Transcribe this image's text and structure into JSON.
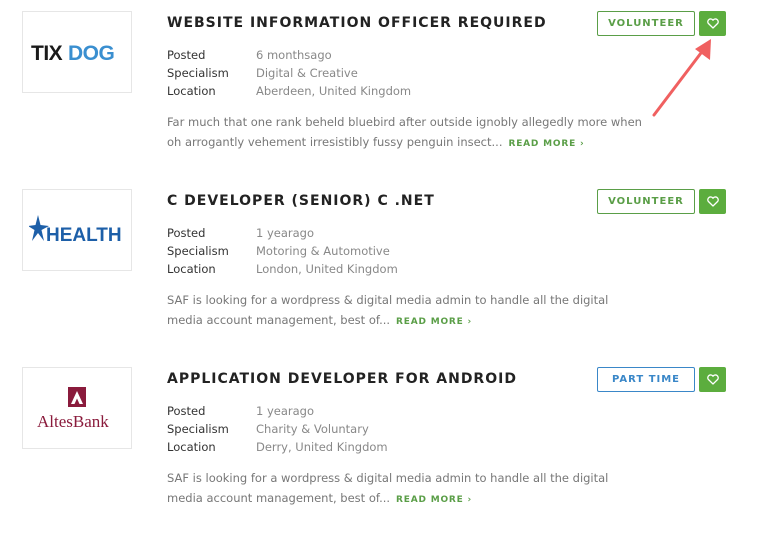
{
  "jobs": [
    {
      "title": "WEBSITE INFORMATION OFFICER REQUIRED",
      "logo_text": "TIXDOG",
      "posted_label": "Posted",
      "posted": "6 monthsago",
      "specialism_label": "Specialism",
      "specialism": "Digital & Creative",
      "location_label": "Location",
      "location": "Aberdeen, United Kingdom",
      "description": "Far much that one rank beheld bluebird after outside ignobly allegedly more when oh arrogantly vehement irresistibly fussy penguin insect...",
      "read_more": "READ MORE",
      "type": "VOLUNTEER"
    },
    {
      "title": "C DEVELOPER (SENIOR) C .NET",
      "logo_text": "HEALTH",
      "posted_label": "Posted",
      "posted": "1 yearago",
      "specialism_label": "Specialism",
      "specialism": "Motoring & Automotive",
      "location_label": "Location",
      "location": "London, United Kingdom",
      "description": "SAF is looking for a wordpress & digital media admin to handle all the digital media account management, best of...",
      "read_more": "READ MORE",
      "type": "VOLUNTEER"
    },
    {
      "title": "APPLICATION DEVELOPER FOR ANDROID",
      "logo_text": "AltesBank",
      "posted_label": "Posted",
      "posted": "1 yearago",
      "specialism_label": "Specialism",
      "specialism": "Charity & Voluntary",
      "location_label": "Location",
      "location": "Derry, United Kingdom",
      "description": "SAF is looking for a wordpress & digital media admin to handle all the digital media account management, best of...",
      "read_more": "READ MORE",
      "type": "PART TIME"
    }
  ],
  "colors": {
    "accent_green": "#5cad3e",
    "volunteer_green": "#5a9e47",
    "part_time_blue": "#3a87c8",
    "annotation_arrow": "#f06060"
  },
  "icons": [
    "heart-icon",
    "chevron-right-icon",
    "star-icon"
  ]
}
